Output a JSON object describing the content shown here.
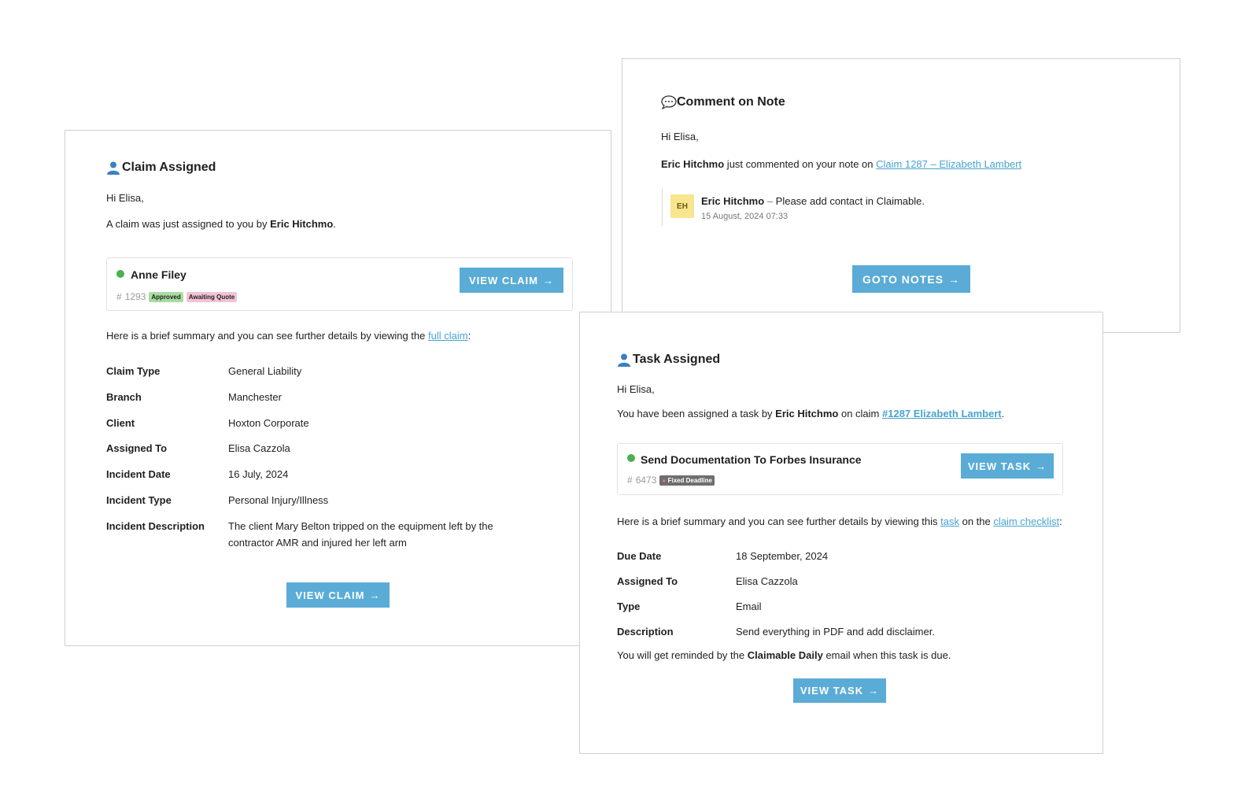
{
  "claim_email": {
    "title": "Claim Assigned",
    "greeting": "Hi Elisa,",
    "intro_prefix": "A claim was just assigned to you by ",
    "intro_actor": "Eric Hitchmo",
    "intro_suffix": ".",
    "item": {
      "name": "Anne Filey",
      "hash": "#",
      "number": "1293",
      "badges": [
        "Approved",
        "Awaiting Quote"
      ],
      "button_label": "VIEW CLAIM"
    },
    "summary_prefix": "Here is a brief summary and you can see further details by viewing the ",
    "summary_link": "full claim",
    "summary_suffix": ":",
    "details": [
      {
        "label": "Claim Type",
        "value": "General Liability"
      },
      {
        "label": "Branch",
        "value": "Manchester"
      },
      {
        "label": "Client",
        "value": "Hoxton Corporate"
      },
      {
        "label": "Assigned To",
        "value": "Elisa Cazzola"
      },
      {
        "label": "Incident Date",
        "value": "16 July, 2024"
      },
      {
        "label": "Incident Type",
        "value": "Personal Injury/Illness"
      },
      {
        "label": "Incident Description",
        "value_line1": "The client Mary Belton tripped on the equipment left by the",
        "value_line2": "contractor AMR and injured her left arm"
      }
    ],
    "button_label": "VIEW CLAIM",
    "arrow": "→"
  },
  "note_email": {
    "title": "Comment on Note",
    "greeting": "Hi Elisa,",
    "actor": "Eric Hitchmo",
    "message_mid": " just commented on your note on ",
    "link": "Claim 1287 – Elizabeth Lambert",
    "comment": {
      "initials": "EH",
      "author": "Eric Hitchmo",
      "separator": " – ",
      "text": "Please add contact in Claimable.",
      "timestamp": "15 August, 2024 07:33"
    },
    "button_label": "GOTO NOTES",
    "arrow": "→"
  },
  "task_email": {
    "title": "Task Assigned",
    "greeting": "Hi Elisa,",
    "intro_prefix": "You have been assigned a task by ",
    "intro_actor": "Eric Hitchmo",
    "intro_mid": " on claim ",
    "intro_link": "#1287 Elizabeth Lambert",
    "intro_suffix": ".",
    "item": {
      "name": "Send Documentation To Forbes Insurance",
      "hash": "#",
      "number": "6473",
      "badge": "Fixed Deadline",
      "button_label": "VIEW TASK"
    },
    "summary_prefix": "Here is a brief summary and you can see further details by viewing this ",
    "summary_link1": "task",
    "summary_mid": " on the ",
    "summary_link2": "claim checklist",
    "summary_suffix": ":",
    "details": [
      {
        "label": "Due Date",
        "value": "18 September, 2024"
      },
      {
        "label": "Assigned To",
        "value": "Elisa Cazzola"
      },
      {
        "label": "Type",
        "value": "Email"
      },
      {
        "label": "Description",
        "value": "Send everything in PDF and add disclaimer."
      }
    ],
    "reminder_prefix": "You will get reminded by the ",
    "reminder_bold": "Claimable Daily",
    "reminder_suffix": " email when this task is due.",
    "button_label": "VIEW TASK",
    "arrow": "→"
  },
  "colors": {
    "button": "#5aacd6",
    "link": "#4aa3d0",
    "status_dot": "#4caf50",
    "person_icon": "#3b7fc4"
  }
}
